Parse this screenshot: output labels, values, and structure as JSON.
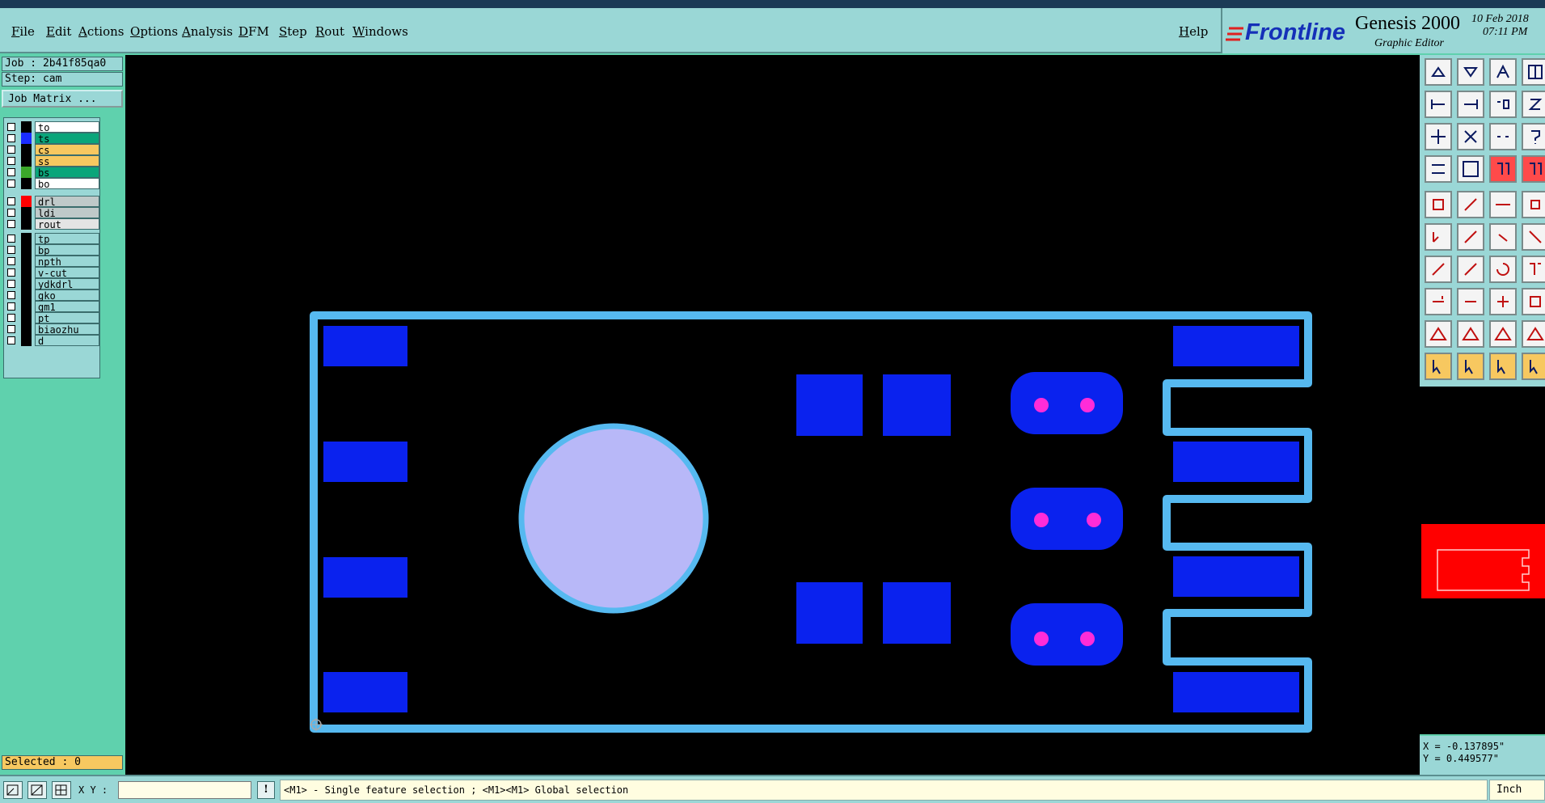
{
  "menu": [
    "File",
    "Edit",
    "Actions",
    "Options",
    "Analysis",
    "DFM",
    "Step",
    "Rout",
    "Windows"
  ],
  "help_label": "Help",
  "logo": {
    "brand": "Frontline",
    "product": "Genesis 2000",
    "subtitle": "Graphic Editor",
    "date": "10 Feb 2018",
    "time": "07:11 PM"
  },
  "job_label": "Job : 2b41f85qa0",
  "step_label": "Step: cam",
  "job_matrix_label": "Job Matrix ...",
  "layers": [
    {
      "name": "to",
      "color": "#ffffff",
      "swatch": "#000000"
    },
    {
      "name": "ts",
      "color": "#0aa57a",
      "swatch": "#1a2cff"
    },
    {
      "name": "cs",
      "color": "#f7c860",
      "swatch": "#000000"
    },
    {
      "name": "ss",
      "color": "#f7c860",
      "swatch": "#000000"
    },
    {
      "name": "bs",
      "color": "#0aa57a",
      "swatch": "#3ba82a"
    },
    {
      "name": "bo",
      "color": "#ffffff",
      "swatch": "#000000"
    },
    {
      "name": "drl",
      "color": "#bfc9c9",
      "swatch": "#ff0000"
    },
    {
      "name": "ldi",
      "color": "#bfc9c9",
      "swatch": "#000000"
    },
    {
      "name": "rout",
      "color": "#e4e4e4",
      "swatch": "#000000"
    },
    {
      "name": "tp",
      "color": "#9ad7d6",
      "swatch": "#000000"
    },
    {
      "name": "bp",
      "color": "#9ad7d6",
      "swatch": "#000000"
    },
    {
      "name": "npth",
      "color": "#9ad7d6",
      "swatch": "#000000"
    },
    {
      "name": "v-cut",
      "color": "#9ad7d6",
      "swatch": "#000000"
    },
    {
      "name": "ydkdrl",
      "color": "#9ad7d6",
      "swatch": "#000000"
    },
    {
      "name": "gko",
      "color": "#9ad7d6",
      "swatch": "#000000"
    },
    {
      "name": "gm1",
      "color": "#9ad7d6",
      "swatch": "#000000"
    },
    {
      "name": "pt",
      "color": "#9ad7d6",
      "swatch": "#000000"
    },
    {
      "name": "biaozhu",
      "color": "#9ad7d6",
      "swatch": "#000000"
    },
    {
      "name": "d",
      "color": "#9ad7d6",
      "swatch": "#000000"
    }
  ],
  "selected_label": "Selected : 0",
  "xy_label": "X Y :",
  "xy_input_value": "",
  "status_message": "<M1> - Single feature selection ; <M1><M1> Global selection",
  "coords": {
    "x": "X = -0.137895\"",
    "y": "Y = 0.449577\""
  },
  "units_label": "Inch",
  "colors": {
    "pad": "#0a22ee",
    "outline": "#56b9f0",
    "circle": "#b8b8f8",
    "hole": "#ff2cd8",
    "panel": "#9ad7d6"
  }
}
